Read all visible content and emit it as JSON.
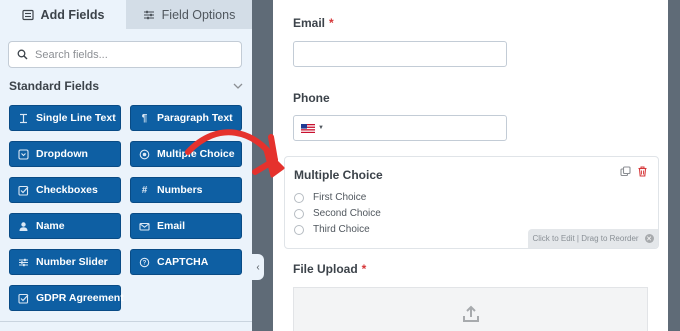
{
  "tabs": {
    "add_fields": "Add Fields",
    "field_options": "Field Options"
  },
  "search": {
    "placeholder": "Search fields..."
  },
  "section": {
    "title": "Standard Fields"
  },
  "fields": [
    {
      "label": "Single Line Text",
      "icon": "text-cursor-icon"
    },
    {
      "label": "Paragraph Text",
      "icon": "paragraph-icon"
    },
    {
      "label": "Dropdown",
      "icon": "dropdown-icon"
    },
    {
      "label": "Multiple Choice",
      "icon": "radio-icon"
    },
    {
      "label": "Checkboxes",
      "icon": "checkbox-icon"
    },
    {
      "label": "Numbers",
      "icon": "hash-icon"
    },
    {
      "label": "Name",
      "icon": "user-icon"
    },
    {
      "label": "Email",
      "icon": "envelope-icon"
    },
    {
      "label": "Number Slider",
      "icon": "slider-icon"
    },
    {
      "label": "CAPTCHA",
      "icon": "captcha-icon"
    },
    {
      "label": "GDPR Agreement",
      "icon": "gdpr-checkbox-icon"
    }
  ],
  "form": {
    "email": {
      "label": "Email",
      "required": "*"
    },
    "phone": {
      "label": "Phone"
    },
    "multiple_choice": {
      "label": "Multiple Choice",
      "choices": [
        "First Choice",
        "Second Choice",
        "Third Choice"
      ],
      "reorder_hint": "Click to Edit | Drag to Reorder"
    },
    "file_upload": {
      "label": "File Upload",
      "required": "*"
    }
  },
  "colors": {
    "accent_button": "#0e5fa3",
    "panel_bg": "#ebf3fb",
    "required": "#d63638",
    "arrow": "#e5322d"
  }
}
